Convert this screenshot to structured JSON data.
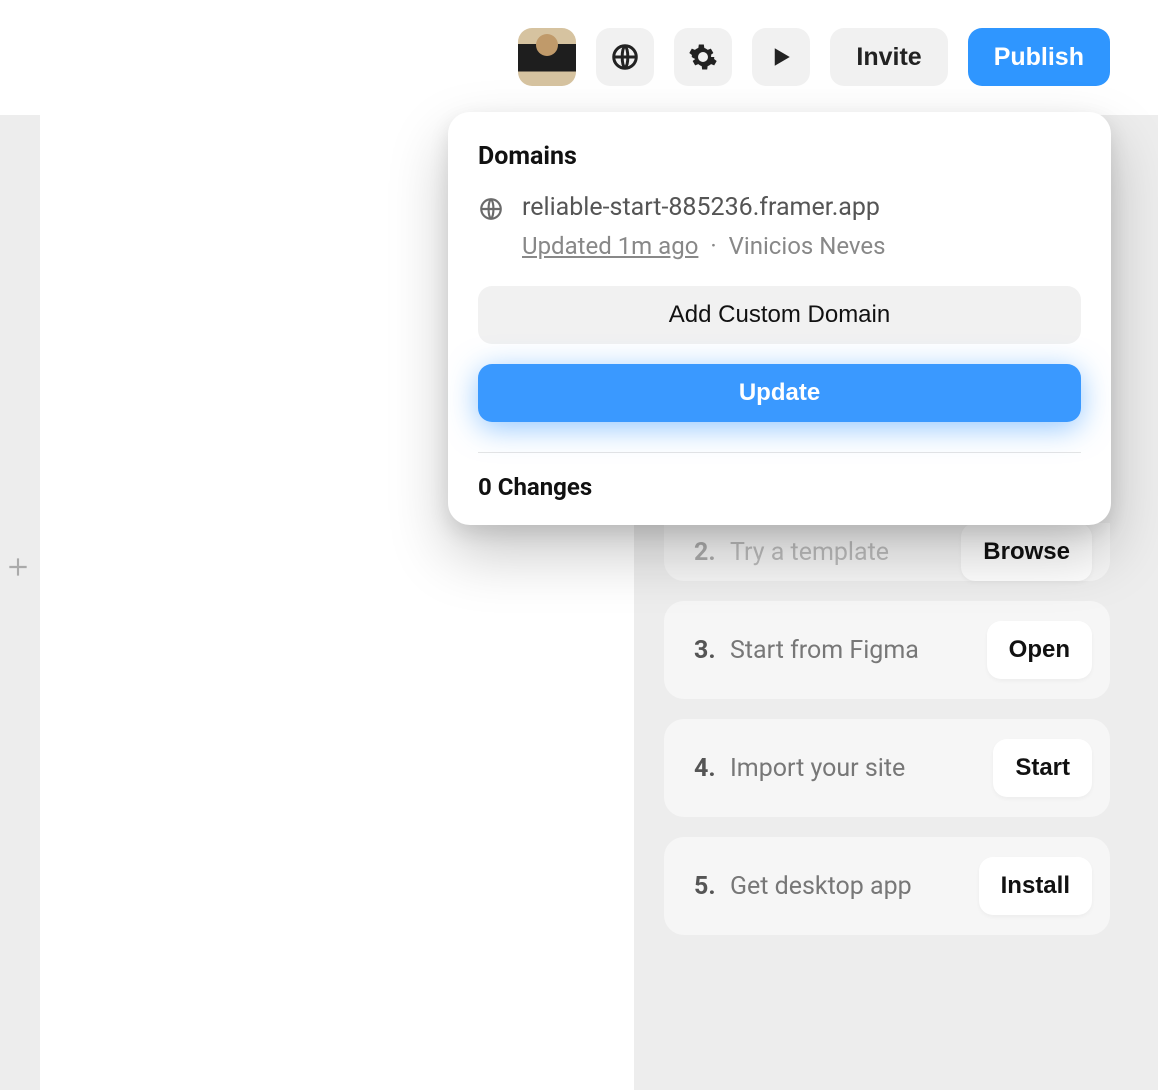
{
  "topbar": {
    "invite_label": "Invite",
    "publish_label": "Publish"
  },
  "popover": {
    "title": "Domains",
    "domain_url": "reliable-start-885236.framer.app",
    "updated_label": "Updated 1m ago",
    "author": "Vinicios Neves",
    "add_domain_label": "Add Custom Domain",
    "update_label": "Update",
    "changes_label": "0 Changes"
  },
  "steps": [
    {
      "num": "2.",
      "label": "Try a template",
      "action": "Browse"
    },
    {
      "num": "3.",
      "label": "Start from Figma",
      "action": "Open"
    },
    {
      "num": "4.",
      "label": "Import your site",
      "action": "Start"
    },
    {
      "num": "5.",
      "label": "Get desktop app",
      "action": "Install"
    }
  ]
}
